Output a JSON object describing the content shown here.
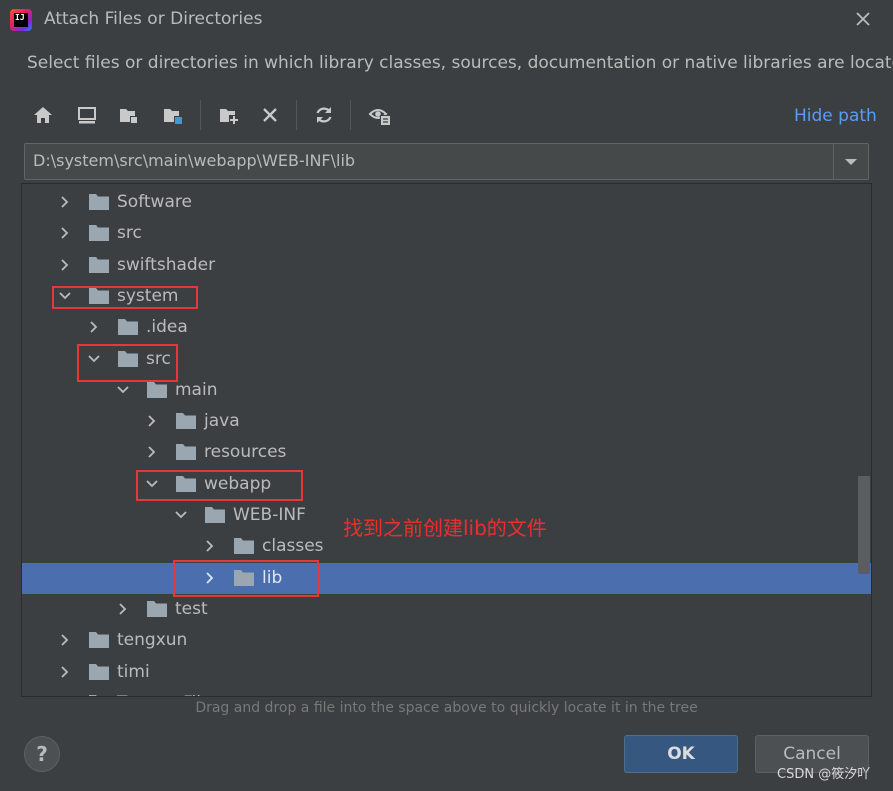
{
  "window": {
    "title": "Attach Files or Directories",
    "description": "Select files or directories in which library classes, sources, documentation or native libraries are located"
  },
  "toolbar": {
    "buttons": [
      {
        "icon": "home-icon"
      },
      {
        "icon": "desktop-icon"
      },
      {
        "icon": "project-folder-icon"
      },
      {
        "icon": "module-folder-icon"
      },
      {
        "icon": "new-folder-icon"
      },
      {
        "icon": "delete-icon"
      },
      {
        "icon": "refresh-icon"
      },
      {
        "icon": "show-hidden-icon"
      }
    ],
    "hide_path_label": "Hide path"
  },
  "path": {
    "value": "D:\\system\\src\\main\\webapp\\WEB-INF\\lib"
  },
  "tree": {
    "rows": [
      {
        "label": "Software",
        "level": 0,
        "expanded": false
      },
      {
        "label": "src",
        "level": 0,
        "expanded": false
      },
      {
        "label": "swiftshader",
        "level": 0,
        "expanded": false
      },
      {
        "label": "system",
        "level": 0,
        "expanded": true
      },
      {
        "label": ".idea",
        "level": 1,
        "expanded": false
      },
      {
        "label": "src",
        "level": 1,
        "expanded": true
      },
      {
        "label": "main",
        "level": 2,
        "expanded": true
      },
      {
        "label": "java",
        "level": 3,
        "expanded": false
      },
      {
        "label": "resources",
        "level": 3,
        "expanded": false
      },
      {
        "label": "webapp",
        "level": 3,
        "expanded": true
      },
      {
        "label": "WEB-INF",
        "level": 4,
        "expanded": true
      },
      {
        "label": "classes",
        "level": 5,
        "expanded": false
      },
      {
        "label": "lib",
        "level": 5,
        "expanded": false,
        "selected": true
      },
      {
        "label": "test",
        "level": 2,
        "expanded": false
      },
      {
        "label": "tengxun",
        "level": 0,
        "expanded": false
      },
      {
        "label": "timi",
        "level": 0,
        "expanded": false
      },
      {
        "label": "TencentFiles",
        "level": 0,
        "expanded": false
      }
    ]
  },
  "annotation": "找到之前创建lib的文件",
  "hint": "Drag and drop a file into the space above to quickly locate it in the tree",
  "buttons": {
    "help": "?",
    "ok": "OK",
    "cancel": "Cancel"
  },
  "watermark": "CSDN @筱汐吖",
  "colors": {
    "background": "#3c3f41",
    "selection": "#4b6eaf",
    "link": "#589df6",
    "highlight_box": "#e5383b",
    "annotation_text": "#ee2d2d",
    "folder": "#9aa7b0"
  }
}
